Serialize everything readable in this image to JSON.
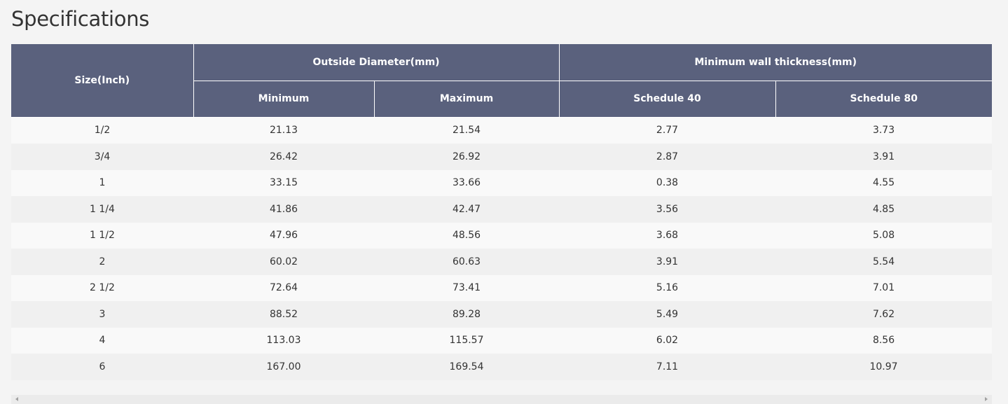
{
  "title": "Specifications",
  "table": {
    "headers": {
      "size": "Size(Inch)",
      "outside_diameter": "Outside Diameter(mm)",
      "min_wall_thickness": "Minimum wall thickness(mm)",
      "minimum": "Minimum",
      "maximum": "Maximum",
      "schedule_40": "Schedule 40",
      "schedule_80": "Schedule 80"
    },
    "rows": [
      [
        "1/2",
        "21.13",
        "21.54",
        "2.77",
        "3.73"
      ],
      [
        "3/4",
        "26.42",
        "26.92",
        "2.87",
        "3.91"
      ],
      [
        "1",
        "33.15",
        "33.66",
        "0.38",
        "4.55"
      ],
      [
        "1 1/4",
        "41.86",
        "42.47",
        "3.56",
        "4.85"
      ],
      [
        "1 1/2",
        "47.96",
        "48.56",
        "3.68",
        "5.08"
      ],
      [
        "2",
        "60.02",
        "60.63",
        "3.91",
        "5.54"
      ],
      [
        "2 1/2",
        "72.64",
        "73.41",
        "5.16",
        "7.01"
      ],
      [
        "3",
        "88.52",
        "89.28",
        "5.49",
        "7.62"
      ],
      [
        "4",
        "113.03",
        "115.57",
        "6.02",
        "8.56"
      ],
      [
        "6",
        "167.00",
        "169.54",
        "7.11",
        "10.97"
      ]
    ]
  },
  "scrollbar": {
    "left_icon": "arrow-left-icon",
    "right_icon": "arrow-right-icon"
  }
}
